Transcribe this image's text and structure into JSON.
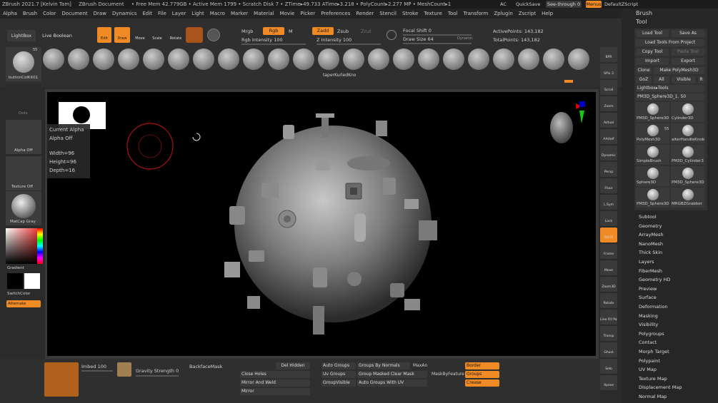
{
  "title_bar": {
    "app": "ZBrush 2021.7 [Kelvin Tam]",
    "doc": "ZBrush Document",
    "stats": "• Free Mem 42.779GB • Active Mem 1799 • Scratch Disk 7 • ZTime▸49.733 ATime▸3.218 • PolyCount▸2.277 MP • MeshCount▸1",
    "ac": "AC",
    "quicksave": "QuickSave",
    "seethrough": "See-through 0",
    "menus": "Menus",
    "script": "DefaultZScript"
  },
  "menus": [
    "Alpha",
    "Brush",
    "Color",
    "Document",
    "Draw",
    "Dynamics",
    "Edit",
    "File",
    "Layer",
    "Light",
    "Macro",
    "Marker",
    "Material",
    "Movie",
    "Picker",
    "Preferences",
    "Render",
    "Stencil",
    "Stroke",
    "Texture",
    "Tool",
    "Transform",
    "Zplugin",
    "Zscript",
    "Help"
  ],
  "top_left": {
    "lightbox": "LightBox",
    "liveboolean": "Live Boolean"
  },
  "modes": {
    "edit": "Edit",
    "draw": "Draw",
    "move": "Move",
    "scale": "Scale",
    "rotate": "Rotate"
  },
  "mrgb": {
    "mrgb": "Mrgb",
    "rgb": "Rgb",
    "m": "M",
    "rgb_intensity": "Rgb Intensity 100"
  },
  "zadd": {
    "zadd": "Zadd",
    "zsub": "Zsub",
    "zcut": "Zcut",
    "z_intensity": "Z Intensity 100"
  },
  "focal": {
    "focal": "Focal Shift 0",
    "draw_size": "Draw Size 64",
    "dynamic": "Dynamic"
  },
  "points": {
    "active": "ActivePoints: 143,182",
    "total": "TotalPoints: 143,182"
  },
  "shelf_labels": [
    "",
    "taperKurledKno",
    ""
  ],
  "left_panel": {
    "brush_name": "buttonColKit01",
    "brush_count": "55",
    "dots": "Dots",
    "alpha": "Alpha Off",
    "texture": "Texture Off",
    "matcap": "MatCap Gray",
    "gradient": "Gradient",
    "switch": "SwitchColor",
    "alternate": "Alternate"
  },
  "alpha_popup": {
    "title": "Current Alpha",
    "name": "Alpha Off",
    "width": "Width=96",
    "height": "Height=96",
    "depth": "Depth=16"
  },
  "right_tools": [
    "BPR",
    "SPix 3",
    "Scroll",
    "Zoom",
    "Actual",
    "AAHalf",
    "Dynamic",
    "Persp",
    "Floor",
    "L.Sym",
    "Lock",
    "QXYZ",
    "Frame",
    "Move",
    "Zoom3D",
    "Rotate",
    "Line Fill PolyF",
    "Transp",
    "Ghost",
    "Solo",
    "Xpose"
  ],
  "brush_panel": {
    "brush": "Brush",
    "tool": "Tool",
    "load": "Load Tool",
    "save": "Save As",
    "load_project": "Load Tools From Project",
    "copy": "Copy Tool",
    "paste": "Paste Tool",
    "import": "Import",
    "export": "Export",
    "clone": "Clone",
    "make": "Make PolyMesh3D",
    "goz": "GoZ",
    "all": "All",
    "visible": "Visible",
    "r": "R",
    "lightbox_tools": "Lightbox▸Tools",
    "current": "PM3D_Sphere3D_1. 50",
    "tools": [
      "PM3D_Sphere3D",
      "Cylinder3D",
      "PolyMesh3D",
      "alterHandleKnob",
      "SimpleBrush",
      "PM3D_Cylinder3",
      "Sphere3D",
      "PM3D_Sphere3D",
      "PM3D_Sphere3D",
      "MRGBZGrabber"
    ],
    "tool_count": "55"
  },
  "submenus": [
    "Subtool",
    "Geometry",
    "ArrayMesh",
    "NanoMesh",
    "Thick Skin",
    "Layers",
    "FiberMesh",
    "Geometry HD",
    "Preview",
    "Surface",
    "Deformation",
    "Masking",
    "Visibility",
    "Polygroups",
    "Contact",
    "Morph Target",
    "Polypaint",
    "UV Map",
    "Texture Map",
    "Displacement Map",
    "Normal Map"
  ],
  "bottom": {
    "imbed": "Imbed 100",
    "gravity": "Gravity Strength 0",
    "backface": "BackfaceMask",
    "del_hidden": "Del Hidden",
    "close_holes": "Close Holes",
    "mirror_weld": "Mirror And Weld",
    "mirror": "Mirror",
    "auto_groups": "Auto Groups",
    "uv_groups": "Uv Groups",
    "groupvisible": "GroupVisible",
    "by_normals": "Groups By Normals",
    "maxang": "MaxAn",
    "masked_clear": "Group Masked Clear Mask",
    "with_uv": "Auto Groups With UV",
    "maskbyfeature": "MaskByFeature",
    "border": "Border",
    "groups": "Groups",
    "crease": "Crease"
  }
}
